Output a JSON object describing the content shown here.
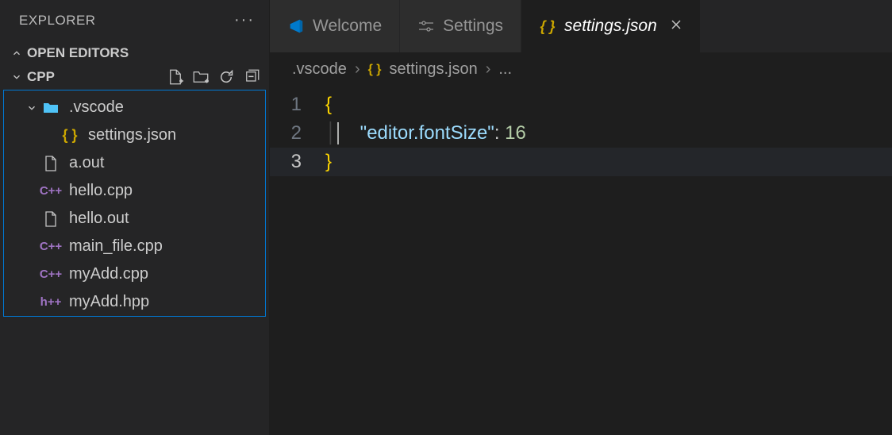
{
  "sidebar": {
    "title": "EXPLORER",
    "sections": {
      "open_editors": "OPEN EDITORS",
      "workspace": "CPP"
    },
    "tree": [
      {
        "name": ".vscode",
        "type": "folder",
        "expanded": true
      },
      {
        "name": "settings.json",
        "type": "json",
        "nested": true
      },
      {
        "name": "a.out",
        "type": "file"
      },
      {
        "name": "hello.cpp",
        "type": "cpp"
      },
      {
        "name": "hello.out",
        "type": "file"
      },
      {
        "name": "main_file.cpp",
        "type": "cpp"
      },
      {
        "name": "myAdd.cpp",
        "type": "cpp"
      },
      {
        "name": "myAdd.hpp",
        "type": "hpp"
      }
    ]
  },
  "tabs": [
    {
      "label": "Welcome",
      "icon": "vscode"
    },
    {
      "label": "Settings",
      "icon": "settings"
    },
    {
      "label": "settings.json",
      "icon": "json",
      "active": true,
      "italic": true,
      "closeable": true
    }
  ],
  "breadcrumb": {
    "segments": [
      ".vscode",
      "settings.json",
      "..."
    ]
  },
  "editor": {
    "lines": [
      {
        "num": "1",
        "tokens": [
          [
            "brace",
            "{"
          ]
        ]
      },
      {
        "num": "2",
        "tokens": [
          [
            "guide",
            ""
          ],
          [
            "indent",
            "    "
          ],
          [
            "str",
            "\"editor.fontSize\""
          ],
          [
            "colon",
            ": "
          ],
          [
            "num",
            "16"
          ]
        ]
      },
      {
        "num": "3",
        "tokens": [
          [
            "brace",
            "}"
          ]
        ],
        "current": true
      }
    ]
  }
}
